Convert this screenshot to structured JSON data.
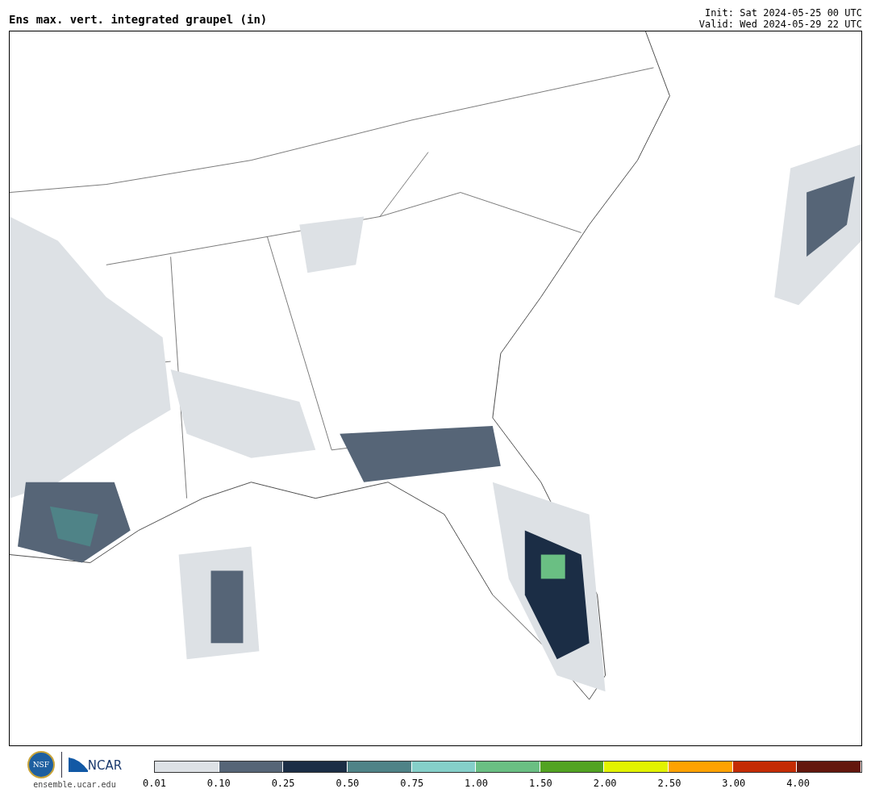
{
  "title": "Ens max. vert. integrated graupel (in)",
  "init": "Init: Sat 2024-05-25 00 UTC",
  "valid": "Valid: Wed 2024-05-29 22 UTC",
  "logos": {
    "nsf": "NSF",
    "ncar": "NCAR",
    "site": "ensemble.ucar.edu"
  },
  "colorbar": [
    {
      "color": "#dde1e5"
    },
    {
      "color": "#566577"
    },
    {
      "color": "#1b2d45"
    },
    {
      "color": "#4f8387"
    },
    {
      "color": "#85cfc9"
    },
    {
      "color": "#6abf83"
    },
    {
      "color": "#52a322"
    },
    {
      "color": "#e2f300"
    },
    {
      "color": "#fea201"
    },
    {
      "color": "#c42c04"
    },
    {
      "color": "#63170d"
    }
  ],
  "ticks": [
    "0.01",
    "0.10",
    "0.25",
    "0.50",
    "0.75",
    "1.00",
    "1.50",
    "2.00",
    "2.50",
    "3.00",
    "4.00"
  ]
}
